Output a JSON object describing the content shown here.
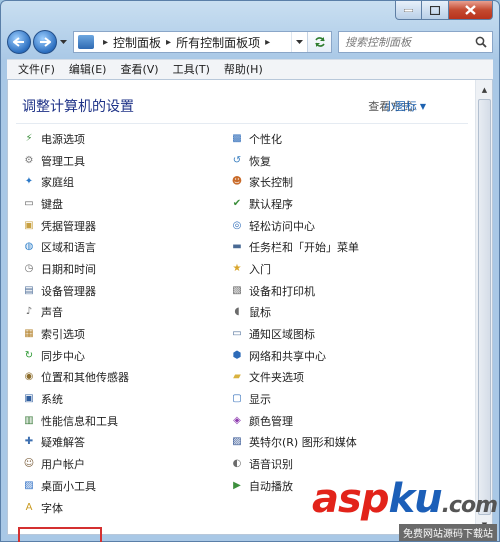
{
  "search": {
    "placeholder": "搜索控制面板"
  },
  "address": {
    "crumbs": [
      "控制面板",
      "所有控制面板项"
    ]
  },
  "menu": {
    "items": [
      "文件(F)",
      "编辑(E)",
      "查看(V)",
      "工具(T)",
      "帮助(H)"
    ]
  },
  "header": {
    "title": "调整计算机的设置",
    "view_by_label": "查看方式:",
    "view_by_value": "小图标"
  },
  "left_items": [
    {
      "label": "电源选项",
      "icon": "power-options-icon"
    },
    {
      "label": "管理工具",
      "icon": "admin-tools-icon"
    },
    {
      "label": "家庭组",
      "icon": "homegroup-icon"
    },
    {
      "label": "键盘",
      "icon": "keyboard-icon"
    },
    {
      "label": "凭据管理器",
      "icon": "credential-manager-icon"
    },
    {
      "label": "区域和语言",
      "icon": "region-language-icon"
    },
    {
      "label": "日期和时间",
      "icon": "date-time-icon"
    },
    {
      "label": "设备管理器",
      "icon": "device-manager-icon"
    },
    {
      "label": "声音",
      "icon": "sound-icon"
    },
    {
      "label": "索引选项",
      "icon": "indexing-options-icon"
    },
    {
      "label": "同步中心",
      "icon": "sync-center-icon"
    },
    {
      "label": "位置和其他传感器",
      "icon": "location-sensors-icon"
    },
    {
      "label": "系统",
      "icon": "system-icon"
    },
    {
      "label": "性能信息和工具",
      "icon": "performance-icon"
    },
    {
      "label": "疑难解答",
      "icon": "troubleshooting-icon"
    },
    {
      "label": "用户帐户",
      "icon": "user-accounts-icon"
    },
    {
      "label": "桌面小工具",
      "icon": "desktop-gadgets-icon"
    },
    {
      "label": "字体",
      "icon": "fonts-icon"
    }
  ],
  "right_items": [
    {
      "label": "个性化",
      "icon": "personalization-icon"
    },
    {
      "label": "恢复",
      "icon": "recovery-icon"
    },
    {
      "label": "家长控制",
      "icon": "parental-controls-icon"
    },
    {
      "label": "默认程序",
      "icon": "default-programs-icon"
    },
    {
      "label": "轻松访问中心",
      "icon": "ease-of-access-icon"
    },
    {
      "label": "任务栏和「开始」菜单",
      "icon": "taskbar-icon"
    },
    {
      "label": "入门",
      "icon": "getting-started-icon"
    },
    {
      "label": "设备和打印机",
      "icon": "devices-printers-icon"
    },
    {
      "label": "鼠标",
      "icon": "mouse-icon"
    },
    {
      "label": "通知区域图标",
      "icon": "notification-area-icon"
    },
    {
      "label": "网络和共享中心",
      "icon": "network-sharing-icon"
    },
    {
      "label": "文件夹选项",
      "icon": "folder-options-icon"
    },
    {
      "label": "显示",
      "icon": "display-icon"
    },
    {
      "label": "颜色管理",
      "icon": "color-management-icon"
    },
    {
      "label": "英特尔(R) 图形和媒体",
      "icon": "intel-graphics-icon"
    },
    {
      "label": "语音识别",
      "icon": "speech-recognition-icon"
    },
    {
      "label": "自动播放",
      "icon": "autoplay-icon"
    }
  ],
  "highlighted_item": "用户帐户",
  "watermark": {
    "brand_a": "asp",
    "brand_b": "ku",
    "brand_c": ".com",
    "sub": "免费网站源码下载站"
  },
  "colors": {
    "title_blue": "#1e3287",
    "link_blue": "#1e62b0",
    "highlight_red": "#d43030"
  }
}
